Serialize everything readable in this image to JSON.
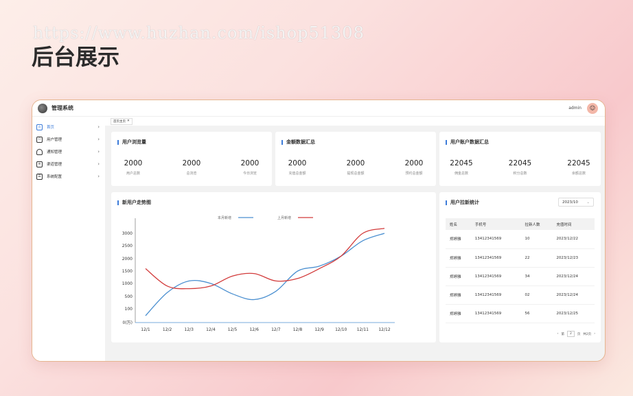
{
  "watermark": "https://www.huzhan.com/ishop51308",
  "hero_title": "后台展示",
  "app": {
    "title": "管理系统",
    "admin_name": "admin"
  },
  "sidebar": {
    "items": [
      {
        "label": "首页",
        "icon": "home-icon",
        "active": true
      },
      {
        "label": "用户管理",
        "icon": "user-icon",
        "active": false
      },
      {
        "label": "通知管理",
        "icon": "bell-icon",
        "active": false
      },
      {
        "label": "渠道管理",
        "icon": "channel-icon",
        "active": false
      },
      {
        "label": "系统配置",
        "icon": "settings-icon",
        "active": false
      }
    ]
  },
  "tabs": [
    {
      "label": "首页主页",
      "close": "✕"
    }
  ],
  "cards": {
    "browse": {
      "title": "用户浏览量",
      "stats": [
        {
          "value": "2000",
          "label": "用户总数"
        },
        {
          "value": "2000",
          "label": "总浏览"
        },
        {
          "value": "2000",
          "label": "今日浏览"
        }
      ]
    },
    "amount": {
      "title": "金额数据汇总",
      "stats": [
        {
          "value": "2000",
          "label": "充值总金额"
        },
        {
          "value": "2000",
          "label": "提现总金额"
        },
        {
          "value": "2000",
          "label": "预约总金额"
        }
      ]
    },
    "account": {
      "title": "用户账户数据汇总",
      "stats": [
        {
          "value": "22045",
          "label": "佣金总数"
        },
        {
          "value": "22045",
          "label": "积分总数"
        },
        {
          "value": "22045",
          "label": "余额总数"
        }
      ]
    }
  },
  "trend": {
    "title": "新用户走势图"
  },
  "chart_data": {
    "type": "line",
    "title": "",
    "categories": [
      "12/1",
      "12/2",
      "12/3",
      "12/4",
      "12/5",
      "12/6",
      "12/7",
      "12/8",
      "12/9",
      "12/10",
      "12/11",
      "12/12"
    ],
    "series": [
      {
        "name": "本月新增",
        "color": "#4a8fd0",
        "values": [
          50,
          650,
          1100,
          1000,
          600,
          400,
          700,
          1500,
          1700,
          2100,
          2700,
          3000
        ]
      },
      {
        "name": "上月新增",
        "color": "#d23a3a",
        "values": [
          1600,
          900,
          800,
          900,
          1300,
          1400,
          1100,
          1200,
          1600,
          2100,
          3000,
          3200
        ]
      }
    ],
    "y_ticks": [
      "0(万)",
      "100",
      "500",
      "1000",
      "1500",
      "2000",
      "2500",
      "3000"
    ],
    "ylim": [
      0,
      3300
    ],
    "legend": "top",
    "grid": false
  },
  "pull": {
    "title": "用户拉新统计",
    "select_value": "2023/10",
    "columns": [
      "姓名",
      "手机号",
      "拉新人数",
      "充值时间"
    ],
    "rows": [
      [
        "郑婷雅",
        "13412341569",
        "10",
        "2023/12/22"
      ],
      [
        "郑婷雅",
        "13412341569",
        "22",
        "2023/12/23"
      ],
      [
        "郑婷雅",
        "13412341569",
        "34",
        "2023/12/24"
      ],
      [
        "郑婷雅",
        "13412341569",
        "02",
        "2023/12/24"
      ],
      [
        "郑婷雅",
        "13412341569",
        "56",
        "2023/12/25"
      ]
    ],
    "pager": {
      "prev": "‹",
      "prefix": "第",
      "page": "2",
      "suffix": "页",
      "total": "共2页",
      "next": "›"
    }
  }
}
